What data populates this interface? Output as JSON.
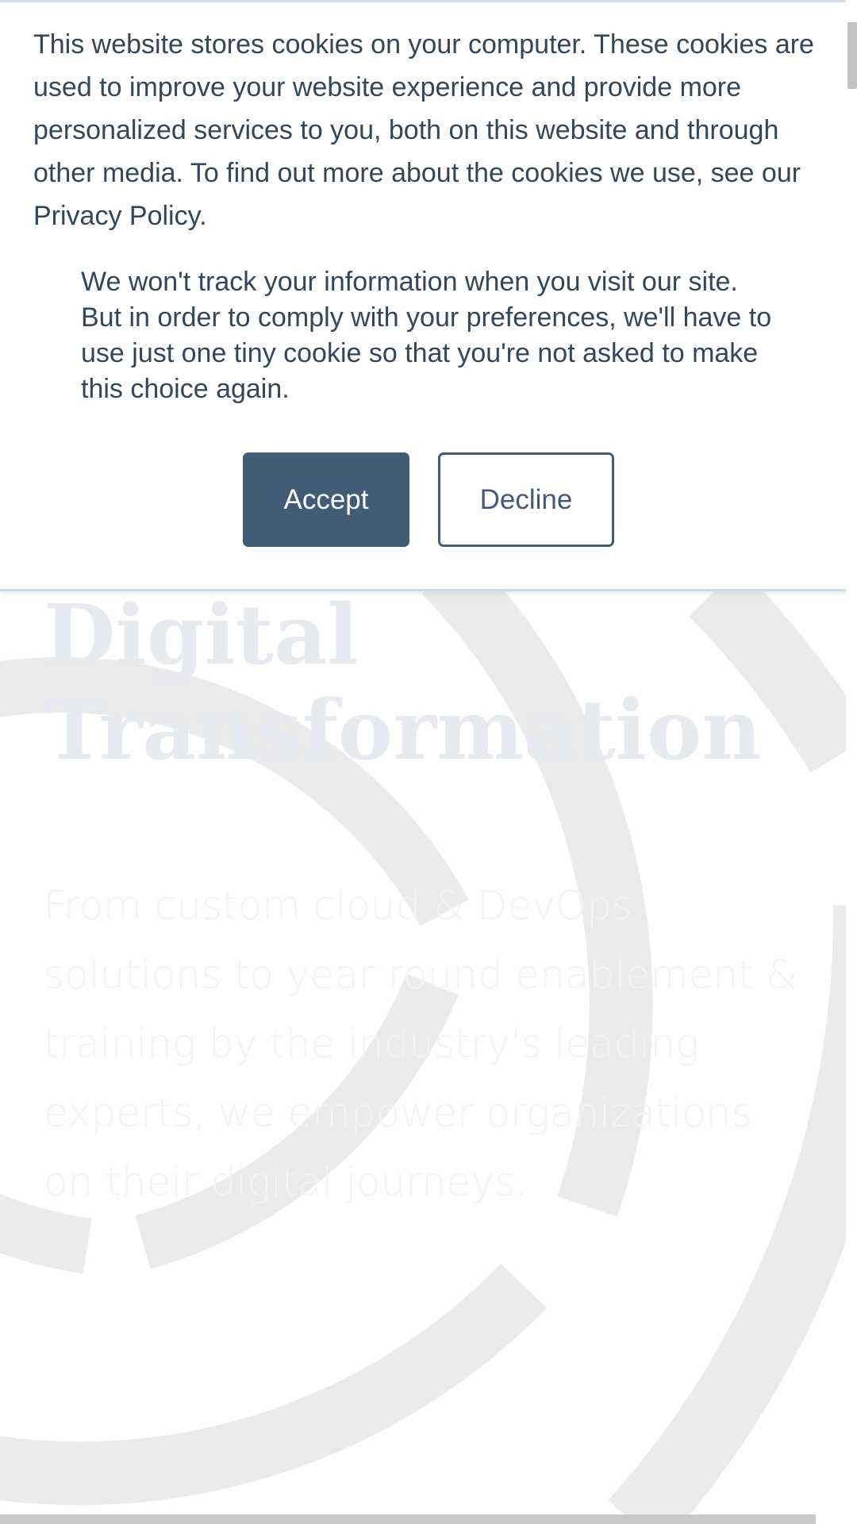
{
  "cookie_banner": {
    "message": "This website stores cookies on your computer. These cookies are used to improve your website experience and provide more personalized services to you, both on this website and through other media. To find out more about the cookies we use, see our Privacy Policy.",
    "decline_info": "We won't track your information when you visit our site. But in order to comply with your preferences, we'll have to use just one tiny cookie so that you're not asked to make this choice again.",
    "accept_label": "Accept",
    "decline_label": "Decline"
  },
  "hero": {
    "title_line1": "Digital",
    "title_line2": "Transformation",
    "subtitle": "From custom cloud & DevOps solutions to year round enablement & training by the industry's leading experts, we empower organizations on their digital journeys."
  },
  "colors": {
    "accent": "#425b76",
    "text": "#33475b",
    "banner_border": "#d2dde6",
    "ring": "#ebebeb"
  }
}
